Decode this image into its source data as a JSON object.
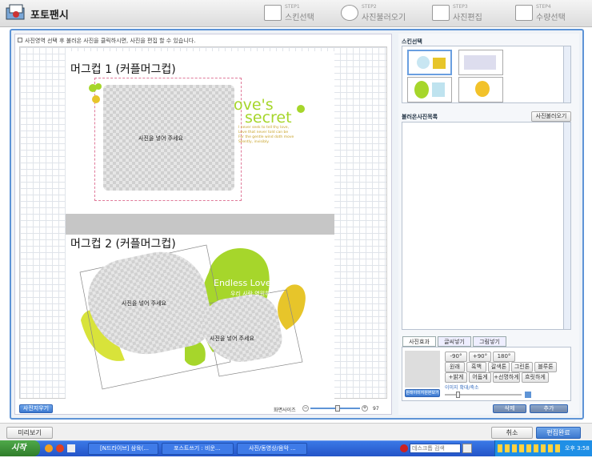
{
  "app": {
    "title": "포토팬시"
  },
  "steps": [
    {
      "num": "STEP1",
      "label": "스킨선택"
    },
    {
      "num": "STEP2",
      "label": "사진불러오기"
    },
    {
      "num": "STEP3",
      "label": "사진편집"
    },
    {
      "num": "STEP4",
      "label": "수량선택"
    }
  ],
  "editor": {
    "hint": "사진영역 선택 후 불러온 사진을 클릭하시면, 사진을 편집 할 수 있습니다.",
    "mug1_title": "머그컵 1 (커플머그컵)",
    "mug2_title": "머그컵 2 (커플머그컵)",
    "placeholder": "사진을 넣어 주세요",
    "deco1_title_a": "ove's",
    "deco1_title_b": "secret",
    "deco1_text": "I never seek to tell thy love,\nLove that never told can be\nFor the gentle wind doth move\nSilently, invisibly.",
    "deco2_title": "Endless Love",
    "deco2_sub": "우리 사랑 영원히",
    "clear_photos": "사진지우기",
    "zoom_label": "화면사이즈",
    "zoom_value": "97",
    "zoom_fraction": 0.55
  },
  "skin": {
    "header": "스킨선택"
  },
  "loaded": {
    "header": "불러온사진목록",
    "load_button": "사진불러오기"
  },
  "tools": {
    "tabs": [
      "사진효과",
      "글씨넣기",
      "그림넣기"
    ],
    "rot_m90": "-90°",
    "rot_p90": "+90°",
    "rot_180": "180°",
    "fx": [
      "원래",
      "흑백",
      "갈색톤",
      "그린톤",
      "블루톤"
    ],
    "fx2": [
      "+밝게",
      "어둡게",
      "+선명하게",
      "흐릿하게"
    ],
    "zoom_label": "이미지 확대/축소",
    "preview_label": "원래이미지원본보기",
    "zoom_fraction": 0.15,
    "delete": "삭제",
    "add": "추가"
  },
  "footer": {
    "preview": "미리보기",
    "cancel": "취소",
    "complete": "편집완료"
  },
  "taskbar": {
    "start": "시작",
    "tasks": [
      "[N드라이브] 삼육(...",
      "포스트쓰기 : 비운...",
      "사진/동영상/음악 ..."
    ],
    "search_placeholder": "데스크톱 검색",
    "clock": "오후 3:58"
  },
  "colors": {
    "accent": "#5e94d6",
    "lime": "#a6d62b",
    "yellow": "#e7c52a"
  }
}
